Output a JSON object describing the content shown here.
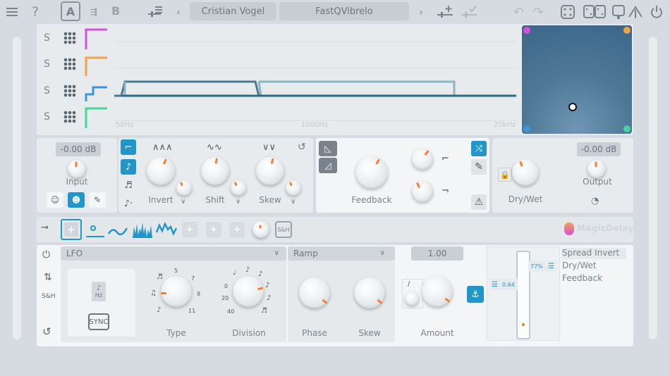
{
  "toolbar": {
    "preset_author": "Cristian Vogel",
    "preset_name": "FastQVibrelo",
    "slot_a_label": "A",
    "slot_b_label": "B"
  },
  "eq": {
    "band_labels": [
      "S",
      "S",
      "S",
      "S"
    ],
    "band_colors": [
      "#d84ddd",
      "#f0a349",
      "#3d94d8",
      "#48d39a"
    ],
    "freq_labels": [
      "50Hz",
      "1000Hz",
      "20kHz"
    ]
  },
  "xy_pad": {
    "corner_colors": [
      "#d84ddd",
      "#f0a349",
      "#3d94d8",
      "#48d39a"
    ]
  },
  "input_section": {
    "gain_value": "-0.00 dB",
    "label": "Input"
  },
  "mod_knobs": {
    "invert_label": "Invert",
    "shift_label": "Shift",
    "skew_label": "Skew"
  },
  "feedback_section": {
    "label": "Feedback"
  },
  "output_section": {
    "drywet_label": "Dry/Wet",
    "gain_value": "-0.00 dB",
    "label": "Output"
  },
  "mod_bar": {
    "sh_label": "S&H",
    "brand": "MagicDelay"
  },
  "lfo": {
    "side_sh_label": "S&H",
    "source": "LFO",
    "shape": "Ramp",
    "amount_value": "1.00",
    "hz_label": "Hz",
    "sync_label": "SYNC",
    "type_label": "Type",
    "division_label": "Division",
    "phase_label": "Phase",
    "skew_label": "Skew",
    "amount_label": "Amount",
    "type_scale": [
      "5",
      "7",
      "9",
      "11"
    ],
    "division_scale": [
      "0",
      "20",
      "40"
    ],
    "slider_tag_a": "77%",
    "slider_tag_b": "0.64",
    "targets": [
      "Spread Invert",
      "Dry/Wet",
      "Feedback"
    ]
  }
}
